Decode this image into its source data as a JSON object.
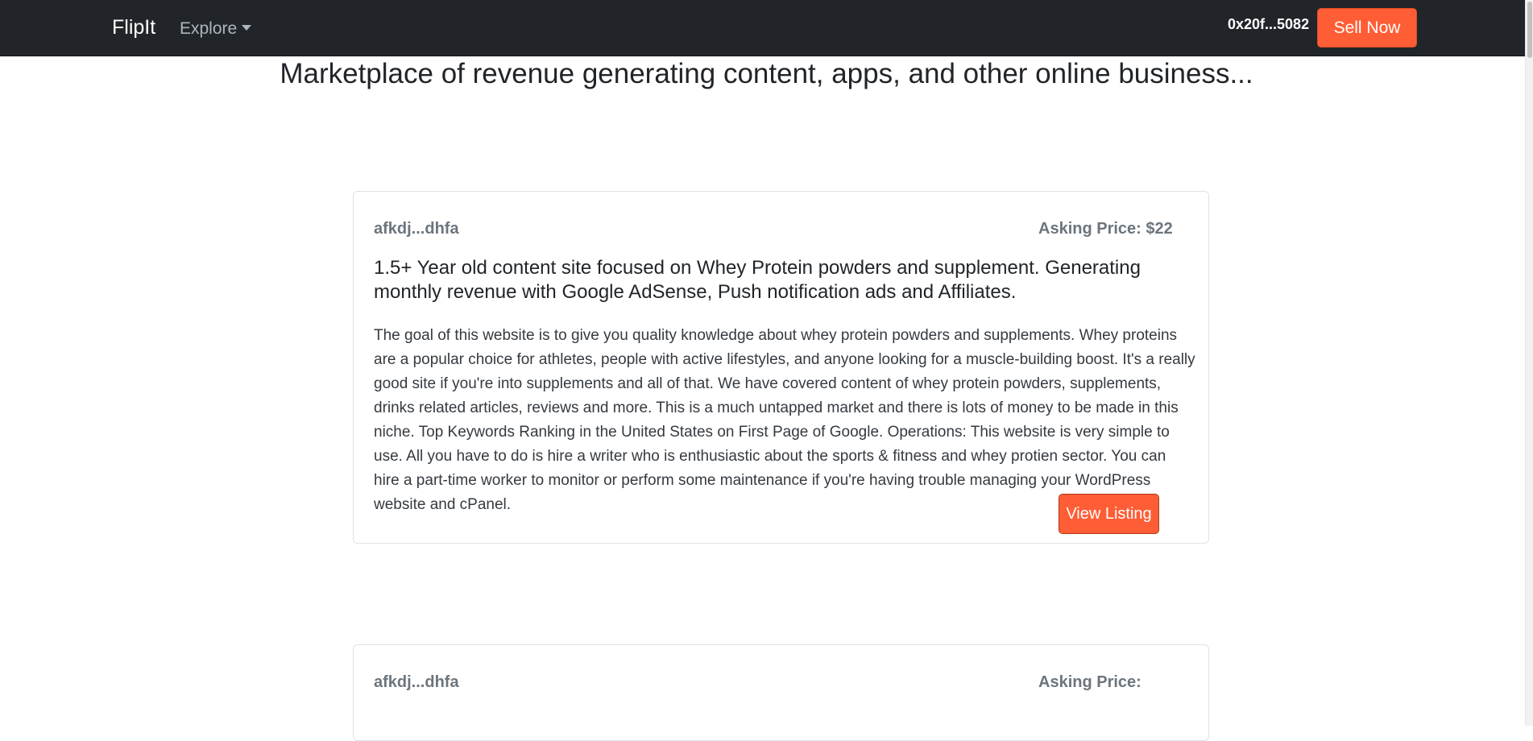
{
  "navbar": {
    "brand": "FlipIt",
    "explore_label": "Explore",
    "wallet_address": "0x20f...5082",
    "sell_button_label": "Sell Now"
  },
  "page": {
    "title": "Marketplace of revenue generating content, apps, and other online business..."
  },
  "listings": [
    {
      "seller": "afkdj...dhfa",
      "asking_price_label": "Asking Price: $22",
      "title": "1.5+ Year old content site focused on Whey Protein powders and supplement. Generating monthly revenue with Google AdSense, Push notification ads and Affiliates.",
      "description": "The goal of this website is to give you quality knowledge about whey protein powders and supplements. Whey proteins are a popular choice for athletes, people with active lifestyles, and anyone looking for a muscle-building boost. It's a really good site if you're into supplements and all of that. We have covered content of whey protein powders, supplements, drinks related articles, reviews and more. This is a much untapped market and there is lots of money to be made in this niche. Top Keywords Ranking in the United States on First Page of Google. Operations: This website is very simple to use. All you have to do is hire a writer who is enthusiastic about the sports & fitness and whey protien sector. You can hire a part-time worker to monitor or perform some maintenance if you're having trouble managing your WordPress website and cPanel.",
      "view_button_label": "View Listing"
    },
    {
      "seller": "afkdj...dhfa",
      "asking_price_label": "Asking Price:"
    }
  ],
  "colors": {
    "navbar_bg": "#212529",
    "accent": "#ff5d35",
    "muted_text": "#6c757d"
  }
}
